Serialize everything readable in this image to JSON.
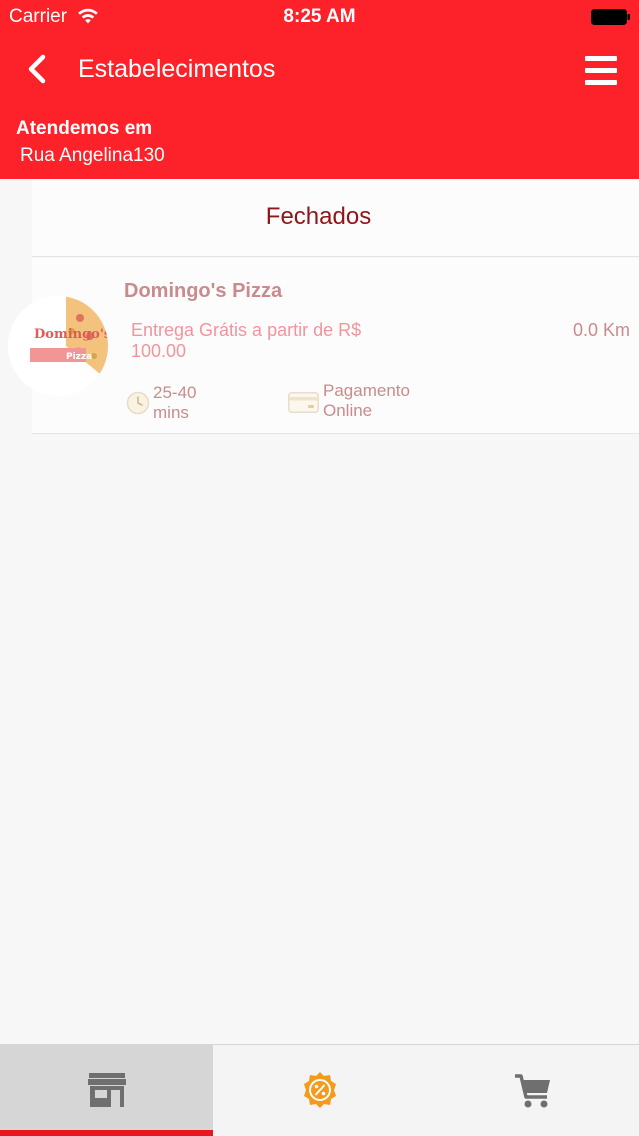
{
  "status_bar": {
    "carrier": "Carrier",
    "time": "8:25 AM"
  },
  "nav": {
    "title": "Estabelecimentos",
    "back_icon": "chevron-left-icon",
    "menu_icon": "hamburger-menu-icon"
  },
  "location": {
    "label": "Atendemos em",
    "address": "Rua Angelina130"
  },
  "section": {
    "title": "Fechados"
  },
  "stores": [
    {
      "name": "Domingo's Pizza",
      "delivery": "Entrega Grátis a partir de R$ 100.00",
      "distance": "0.0 Km",
      "time": "25-40 mins",
      "payment": "Pagamento Online",
      "logo_text": "Domingo's",
      "logo_sub": "Pizza"
    }
  ],
  "tabbar": {
    "tabs": [
      {
        "icon": "store-icon",
        "active": true
      },
      {
        "icon": "discount-badge-icon",
        "active": false
      },
      {
        "icon": "cart-icon",
        "active": false
      }
    ]
  },
  "colors": {
    "header": "#fd2129",
    "section_title": "#8e1518",
    "store_text": "#c98b8d",
    "delivery_text": "#f2959b",
    "tab_indicator": "#e8161d",
    "discount_badge": "#f59a1b"
  }
}
